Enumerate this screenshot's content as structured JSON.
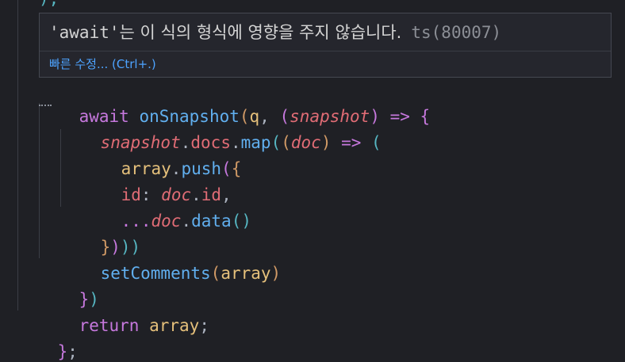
{
  "editor": {
    "top_fragment": "),",
    "hover": {
      "quoted_keyword": "'await'",
      "message": "는 이 식의 형식에 영향을 주지 않습니다.",
      "error_code": "ts(80007)",
      "quick_fix_label": "빠른 수정... (Ctrl+.)"
    },
    "lines": {
      "l1": {
        "kw": "await",
        "fn": "onSnapshot",
        "open": "(",
        "arg": "q",
        "comma": ", ",
        "popen": "(",
        "param": "snapshot",
        "pclose": ")",
        "arrow": " => ",
        "brace": "{"
      },
      "l2": {
        "param": "snapshot",
        "dot1": ".",
        "prop": "docs",
        "dot2": ".",
        "fn": "map",
        "open": "(",
        "popen": "(",
        "param2": "doc",
        "pclose": ")",
        "arrow": " => ",
        "open2": "("
      },
      "l3": {
        "var": "array",
        "dot": ".",
        "fn": "push",
        "open": "(",
        "brace": "{"
      },
      "l4": {
        "key": "id",
        "colon": ": ",
        "param": "doc",
        "dot": ".",
        "prop": "id",
        "comma": ","
      },
      "l5": {
        "spread": "...",
        "param": "doc",
        "dot": ".",
        "fn": "data",
        "call": "()"
      },
      "l6": {
        "close1": "}",
        "close2": ")",
        "close3": ")",
        "close4": ")"
      },
      "l7": {
        "fn": "setComments",
        "open": "(",
        "var": "array",
        "close": ")"
      },
      "l8": {
        "close1": "}",
        "close2": ")"
      },
      "l9": {
        "kw": "return",
        "space": " ",
        "var": "array",
        "semi": ";"
      },
      "l10": {
        "brace": "}",
        "semi": ";"
      }
    }
  }
}
